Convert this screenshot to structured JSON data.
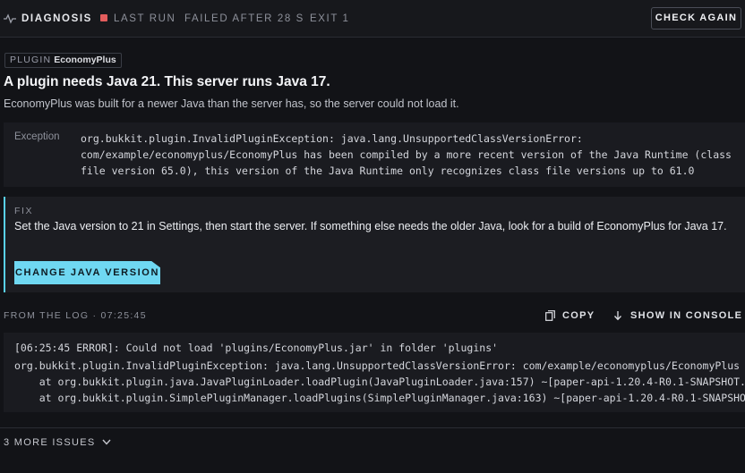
{
  "header": {
    "title": "DIAGNOSIS",
    "last_run": "LAST RUN",
    "failed": "FAILED AFTER 28 S",
    "exit": "EXIT 1",
    "check_again": "CHECK AGAIN",
    "status_color": "#e35d5d"
  },
  "plugin": {
    "label": "PLUGIN",
    "name": "EconomyPlus"
  },
  "headline": "A plugin needs Java 21. This server runs Java 17.",
  "subline": "EconomyPlus was built for a newer Java than the server has, so the server could not load it.",
  "exception": {
    "label": "Exception",
    "text": "org.bukkit.plugin.InvalidPluginException: java.lang.UnsupportedClassVersionError:\ncom/example/economyplus/EconomyPlus has been compiled by a more recent version of the Java Runtime (class\nfile version 65.0), this version of the Java Runtime only recognizes class file versions up to 61.0"
  },
  "fix": {
    "label": "FIX",
    "text": "Set the Java version to 21 in Settings, then start the server. If something else needs the older Java, look for a build of EconomyPlus for Java 17.",
    "button": "CHANGE JAVA VERSION",
    "accent": "#6fd8f2"
  },
  "log": {
    "header": "FROM THE LOG · 07:25:45",
    "copy": "COPY",
    "show_in_console": "SHOW IN CONSOLE",
    "lines": [
      "[06:25:45 ERROR]: Could not load 'plugins/EconomyPlus.jar' in folder 'plugins'",
      "org.bukkit.plugin.InvalidPluginException: java.lang.UnsupportedClassVersionError: com/example/economyplus/EconomyPlus",
      "    at org.bukkit.plugin.java.JavaPluginLoader.loadPlugin(JavaPluginLoader.java:157) ~[paper-api-1.20.4-R0.1-SNAPSHOT.",
      "    at org.bukkit.plugin.SimplePluginManager.loadPlugins(SimplePluginManager.java:163) ~[paper-api-1.20.4-R0.1-SNAPSHO"
    ]
  },
  "more_issues": "3 MORE ISSUES"
}
